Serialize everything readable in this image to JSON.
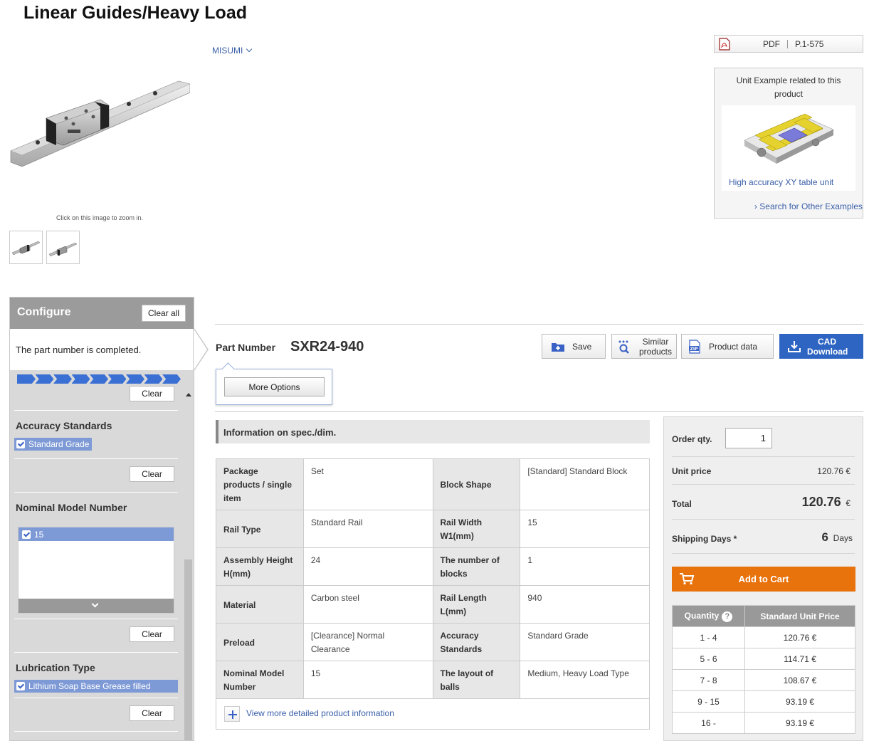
{
  "page_title": "Linear Guides/Heavy Load",
  "brand": "MISUMI",
  "zoom_hint": "Click on this image to zoom in.",
  "pdf": {
    "label": "PDF",
    "page": "P.1-575"
  },
  "unit_example": {
    "title": "Unit Example related to this product",
    "item_label": "High accuracy XY table unit",
    "search_link": "Search for Other Examples"
  },
  "configure": {
    "title": "Configure",
    "clear_all": "Clear all",
    "status": "The part number is completed.",
    "progress_steps": 9,
    "clear_label": "Clear",
    "groups": [
      {
        "title": "Accuracy Standards",
        "selected": "Standard Grade"
      },
      {
        "title": "Nominal Model Number",
        "selected": "15"
      },
      {
        "title": "Lubrication Type",
        "selected": "Lithium Soap Base Grease filled"
      }
    ]
  },
  "part": {
    "label": "Part Number",
    "number": "SXR24-940",
    "more_options": "More Options"
  },
  "actions": {
    "save": "Save",
    "similar": "Similar products",
    "product_data": "Product data",
    "cad": "CAD Download"
  },
  "spec": {
    "header": "Information on spec./dim.",
    "rows": [
      {
        "k1": "Package products / single item",
        "v1": "Set",
        "k2": "Block Shape",
        "v2": "[Standard] Standard Block"
      },
      {
        "k1": "Rail Type",
        "v1": "Standard Rail",
        "k2": "Rail Width W1(mm)",
        "v2": "15"
      },
      {
        "k1": "Assembly Height H(mm)",
        "v1": "24",
        "k2": "The number of blocks",
        "v2": "1"
      },
      {
        "k1": "Material",
        "v1": "Carbon steel",
        "k2": "Rail Length L(mm)",
        "v2": "940"
      },
      {
        "k1": "Preload",
        "v1": "[Clearance] Normal Clearance",
        "k2": "Accuracy Standards",
        "v2": "Standard Grade"
      },
      {
        "k1": "Nominal Model Number",
        "v1": "15",
        "k2": "The layout of balls",
        "v2": "Medium, Heavy Load Type"
      }
    ],
    "more_link": "View more detailed product information"
  },
  "order": {
    "qty_label": "Order qty.",
    "qty_value": "1",
    "unit_price_label": "Unit price",
    "unit_price": "120.76 €",
    "total_label": "Total",
    "total": "120.76",
    "currency": "€",
    "ship_label": "Shipping Days *",
    "ship_days": "6",
    "ship_unit": "Days",
    "add_to_cart": "Add to Cart",
    "price_table": {
      "col_qty": "Quantity",
      "col_price": "Standard Unit Price",
      "rows": [
        {
          "qty": "1 - 4",
          "price": "120.76 €"
        },
        {
          "qty": "5 - 6",
          "price": "114.71 €"
        },
        {
          "qty": "7 - 8",
          "price": "108.67 €"
        },
        {
          "qty": "9 - 15",
          "price": "93.19 €"
        },
        {
          "qty": "16 -",
          "price": "93.19 €"
        }
      ]
    }
  }
}
